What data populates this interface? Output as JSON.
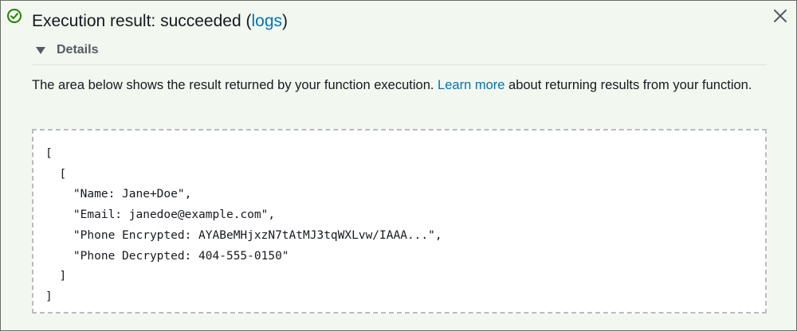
{
  "header": {
    "title_prefix": "Execution result: succeeded (",
    "logs_link": "logs",
    "title_suffix": ")",
    "status_icon": "check-circle-icon",
    "close_icon": "close-icon"
  },
  "details": {
    "label": "Details",
    "expanded": true
  },
  "description": {
    "text_before": "The area below shows the result returned by your function execution. ",
    "learn_more_link": "Learn more",
    "text_after": " about returning results from your function."
  },
  "result": {
    "lines": [
      "[",
      "  [",
      "    \"Name: Jane+Doe\",",
      "    \"Email: janedoe@example.com\",",
      "    \"Phone Encrypted: AYABeMHjxzN7tAtMJ3tqWXLvw/IAAA...\",",
      "    \"Phone Decrypted: 404-555-0150\"",
      "  ]",
      "]"
    ]
  },
  "colors": {
    "success": "#1d8102",
    "link": "#0073bb",
    "panel_bg": "#f2f8f0",
    "text": "#16191f"
  }
}
